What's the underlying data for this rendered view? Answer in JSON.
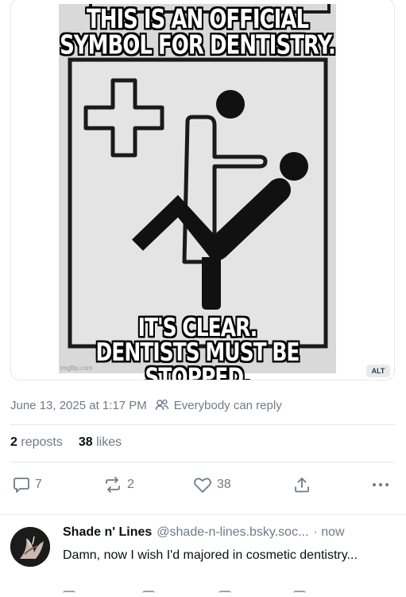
{
  "post": {
    "image": {
      "caption_top": [
        "THIS IS AN OFFICIAL",
        "SYMBOL FOR DENTISTRY."
      ],
      "caption_bottom": [
        "IT'S CLEAR.",
        "DENTISTS MUST BE STOPPED."
      ],
      "watermark": "imgflip.com",
      "alt_label": "ALT"
    },
    "date": "June 13, 2025 at 1:17 PM",
    "reply_setting": "Everybody can reply",
    "reposts_count": "2",
    "reposts_label": "reposts",
    "likes_count": "38",
    "likes_label": "likes",
    "actions": {
      "replies": "7",
      "reposts": "2",
      "likes": "38"
    }
  },
  "reply": {
    "name": "Shade n' Lines",
    "handle": "@shade-n-lines.bsky.soc...",
    "time": "· now",
    "text": "Damn, now I wish I'd majored in cosmetic dentistry..."
  },
  "colors": {
    "muted": "#6f7b89",
    "border": "#e3e7ec",
    "text": "#0b0f14"
  }
}
